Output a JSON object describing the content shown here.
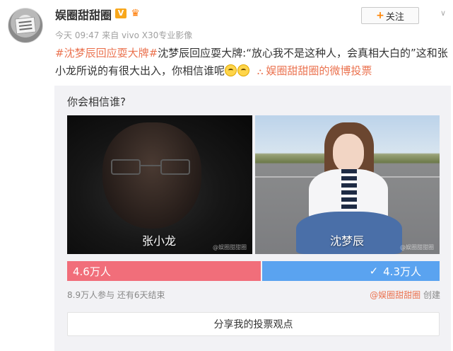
{
  "post": {
    "username": "娱圈甜甜圈",
    "badge_v": "V",
    "badge_extra": "♛",
    "follow_plus": "+",
    "follow_label": "关注",
    "chevron": "∨",
    "meta": "今天 09:47 来自 vivo X30专业影像",
    "hashtag": "#沈梦辰回应耍大牌#",
    "text": "沈梦辰回应耍大牌:“放心我不是这种人，会真相大白的”这和张小龙所说的有很大出入，你相信谁呢",
    "poll_link_icon": "⛬",
    "poll_link": "娱圈甜甜圈的微博投票"
  },
  "poll": {
    "question": "你会相信谁?",
    "options": [
      {
        "name": "张小龙",
        "votes": "4.6万人",
        "share": 0.52,
        "color": "#f16e7a",
        "watermark": "@娱圈甜甜圈"
      },
      {
        "name": "沈梦辰",
        "votes": "4.3万人",
        "share": 0.48,
        "color": "#5aa3f0",
        "check": "✓",
        "watermark": "@娱圈甜甜圈"
      }
    ],
    "stats": "8.9万人参与 还有6天结束",
    "creator_name": "@娱圈甜甜圈",
    "creator_suffix": " 创建",
    "share_button": "分享我的投票观点"
  }
}
